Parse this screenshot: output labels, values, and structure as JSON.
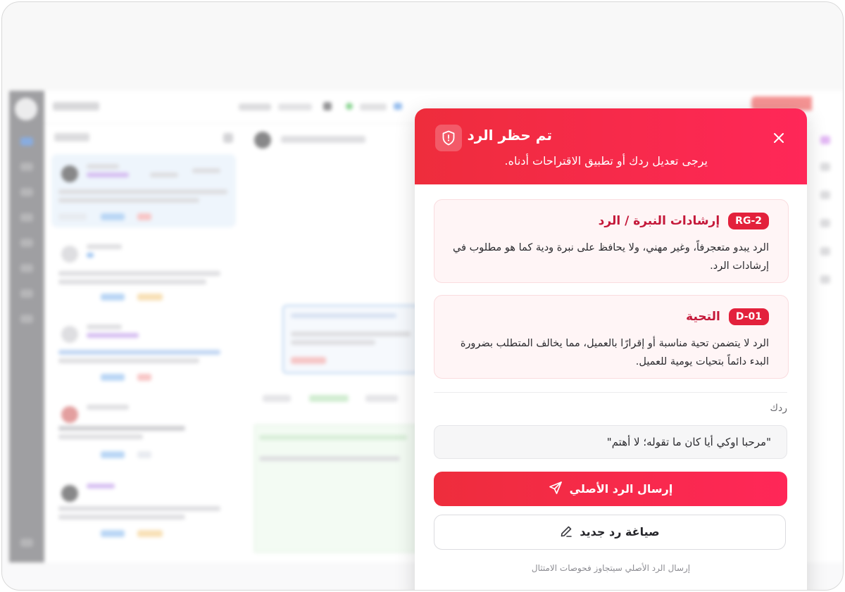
{
  "modal": {
    "title": "تم حظر الرد",
    "subtitle": "يرجى تعديل ردك أو تطبيق الاقتراحات أدناه.",
    "icons": {
      "header": "shield-alert-icon",
      "close": "close-icon"
    },
    "violations": [
      {
        "code": "RG-2",
        "title": "إرشادات النبرة / الرد",
        "description": "الرد يبدو متعجرفاً، وغير مهني، ولا يحافظ على نبرة ودية كما هو مطلوب في إرشادات الرد."
      },
      {
        "code": "D-01",
        "title": "التحية",
        "description": "الرد لا يتضمن تحية مناسبة أو إقرارًا بالعميل، مما يخالف المتطلب بضرورة البدء دائماً بتحيات يومية للعميل."
      }
    ],
    "reply_label": "ردك",
    "reply_text": "\"مرحبا اوكي أيا كان ما تقوله؛ لا أهتم\"",
    "send_original_label": "إرسال الرد الأصلي",
    "send_icon": "send-icon",
    "rewrite_label": "صياغة رد جديد",
    "rewrite_icon": "pencil-icon",
    "bypass_note": "إرسال الرد الأصلي سيتجاوز فحوصات الامتثال"
  },
  "colors": {
    "accent": "#ee2d3c",
    "accent_end": "#ff2758",
    "badge": "#e3213c",
    "rule_title": "#c41839",
    "card_bg": "#fff5f6"
  }
}
